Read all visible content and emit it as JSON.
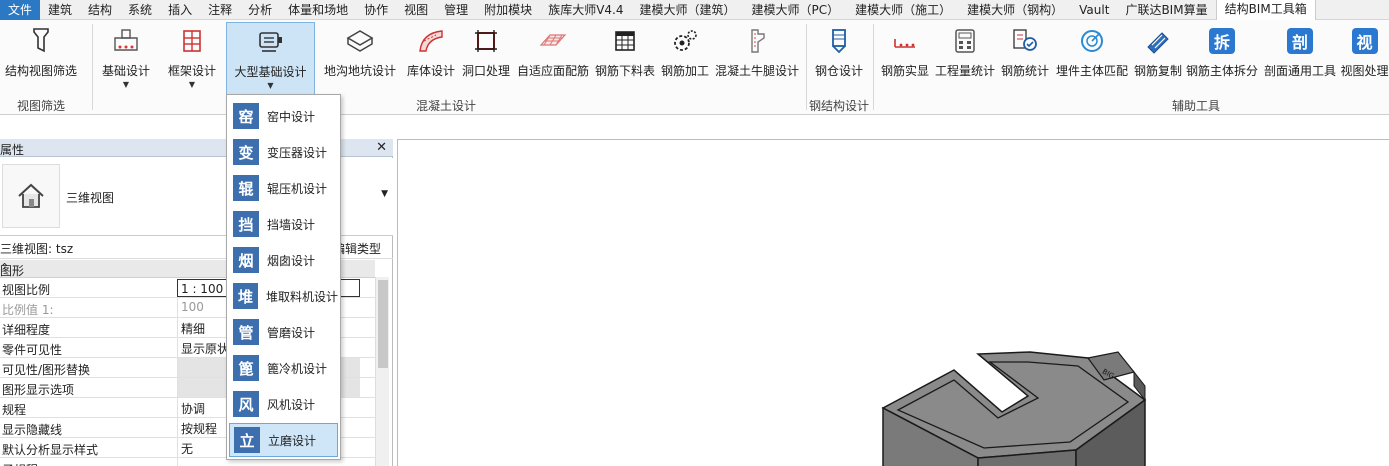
{
  "menubar": {
    "file": "文件",
    "tabs": [
      "建筑",
      "结构",
      "系统",
      "插入",
      "注释",
      "分析",
      "体量和场地",
      "协作",
      "视图",
      "管理",
      "附加模块",
      "族库大师V4.4",
      "建模大师（建筑）",
      "建模大师（PC）",
      "建模大师（施工）",
      "建模大师（钢构）",
      "Vault",
      "广联达BIM算量"
    ],
    "active": "结构BIM工具箱"
  },
  "ribbon": {
    "buttons": [
      {
        "label": "结构视图筛选",
        "icon": "filter-icon"
      },
      {
        "label": "基础设计",
        "icon": "foundation-icon"
      },
      {
        "label": "框架设计",
        "icon": "frame-icon"
      },
      {
        "label": "大型基础设计",
        "icon": "large-foundation-icon"
      },
      {
        "label": "地沟地坑设计",
        "icon": "trench-icon"
      },
      {
        "label": "库体设计",
        "icon": "silo-icon"
      },
      {
        "label": "洞口处理",
        "icon": "opening-icon"
      },
      {
        "label": "自适应面配筋",
        "icon": "surface-rebar-icon"
      },
      {
        "label": "钢筋下料表",
        "icon": "rebar-table-icon"
      },
      {
        "label": "钢筋加工",
        "icon": "rebar-process-icon"
      },
      {
        "label": "混凝土牛腿设计",
        "icon": "corbel-icon"
      },
      {
        "label": "钢仓设计",
        "icon": "steel-bin-icon"
      },
      {
        "label": "钢筋实显",
        "icon": "rebar-display-icon"
      },
      {
        "label": "工程量统计",
        "icon": "quantity-icon"
      },
      {
        "label": "钢筋统计",
        "icon": "rebar-stat-icon"
      },
      {
        "label": "埋件主体匹配",
        "icon": "embed-match-icon"
      },
      {
        "label": "钢筋复制",
        "icon": "rebar-copy-icon"
      },
      {
        "label": "钢筋主体拆分",
        "icon": "rebar-split-icon"
      },
      {
        "label": "剖面通用工具",
        "icon": "section-tool-icon"
      },
      {
        "label": "视图处理",
        "icon": "view-process-icon"
      }
    ],
    "badges": {
      "split": "拆",
      "section": "剖",
      "view": "视"
    },
    "groups": [
      "视图筛选",
      "混凝土设计",
      "钢结构设计",
      "辅助工具"
    ]
  },
  "properties": {
    "title": "属性",
    "close": "✕",
    "type_name": "三维视图",
    "instance_label": "三维视图: tsz",
    "edit_type": "编辑类型",
    "category": "图形",
    "rows": [
      {
        "key": "视图比例",
        "value": "1 : 100"
      },
      {
        "key": "比例值 1:",
        "value": "100"
      },
      {
        "key": "详细程度",
        "value": "精细"
      },
      {
        "key": "零件可见性",
        "value": "显示原状态"
      },
      {
        "key": "可见性/图形替换",
        "value": ""
      },
      {
        "key": "图形显示选项",
        "value": ""
      },
      {
        "key": "规程",
        "value": "协调"
      },
      {
        "key": "显示隐藏线",
        "value": "按规程"
      },
      {
        "key": "默认分析显示样式",
        "value": "无"
      },
      {
        "key": "子规程",
        "value": ""
      }
    ]
  },
  "dropdown": {
    "items": [
      {
        "glyph": "窑",
        "label": "窑中设计"
      },
      {
        "glyph": "变",
        "label": "变压器设计"
      },
      {
        "glyph": "辊",
        "label": "辊压机设计"
      },
      {
        "glyph": "挡",
        "label": "挡墙设计"
      },
      {
        "glyph": "烟",
        "label": "烟囱设计"
      },
      {
        "glyph": "堆",
        "label": "堆取料机设计"
      },
      {
        "glyph": "管",
        "label": "管磨设计"
      },
      {
        "glyph": "篦",
        "label": "篦冷机设计"
      },
      {
        "glyph": "风",
        "label": "风机设计"
      },
      {
        "glyph": "立",
        "label": "立磨设计"
      }
    ]
  },
  "model_label": "BIG"
}
